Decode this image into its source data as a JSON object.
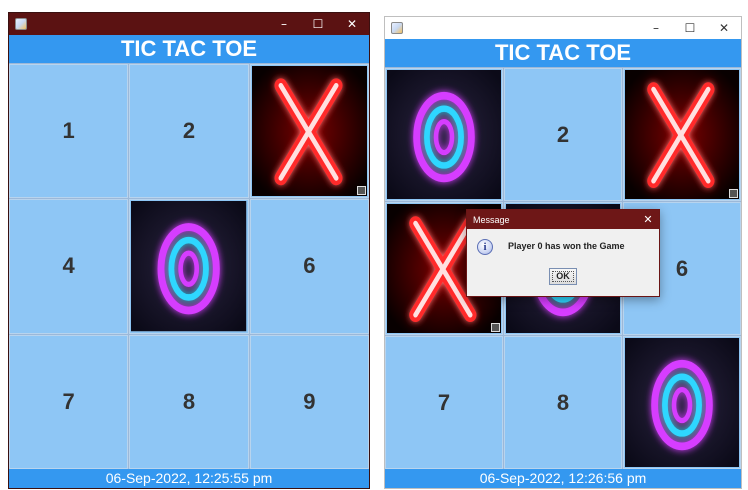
{
  "windows": [
    {
      "header": "TIC TAC TOE",
      "cells": [
        "1",
        "2",
        "X",
        "4",
        "O",
        "6",
        "7",
        "8",
        "9"
      ],
      "footer": "06-Sep-2022, 12:25:55 pm"
    },
    {
      "header": "TIC TAC TOE",
      "cells": [
        "O",
        "2",
        "X",
        "X",
        "",
        "6",
        "7",
        "8",
        "O"
      ],
      "footer": "06-Sep-2022, 12:26:56 pm"
    }
  ],
  "window_controls": {
    "minimize": "–",
    "maximize": "☐",
    "close": "✕"
  },
  "dialog": {
    "title": "Message",
    "close": "✕",
    "message": "Player 0 has won the Game",
    "ok": "OK",
    "icon": "info-icon"
  },
  "colors": {
    "header_blue": "#3498f0",
    "cell_blue": "#8ec6f5",
    "left_titlebar": "#5b1212",
    "dialog_titlebar": "#6e1717"
  }
}
